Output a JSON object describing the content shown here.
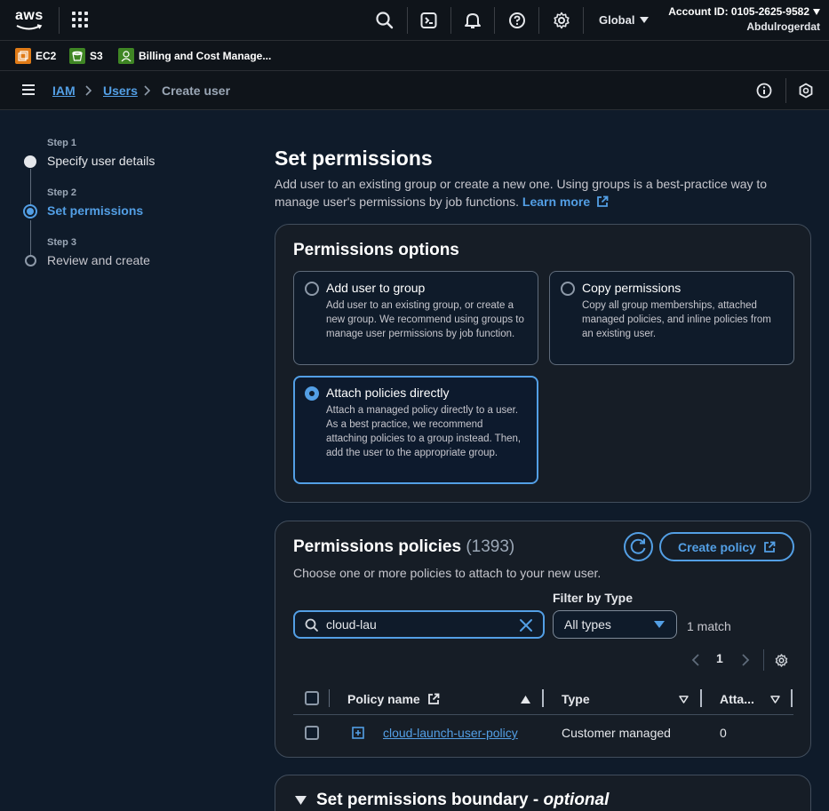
{
  "topnav": {
    "logo_text": "aws",
    "region_label": "Global",
    "account_label": "Account ID: 0105-2625-9582",
    "user_name": "Abdulrogerdat",
    "icons": [
      "grid-icon",
      "search-icon",
      "cloudshell-icon",
      "bell-icon",
      "help-icon",
      "gear-icon"
    ]
  },
  "favorites": [
    {
      "label": "EC2",
      "icon": "ec2-icon",
      "color": "#e07b17"
    },
    {
      "label": "S3",
      "icon": "s3-icon",
      "color": "#3f8624"
    },
    {
      "label": "Billing and Cost Manage...",
      "icon": "billing-icon",
      "color": "#3f8624"
    }
  ],
  "breadcrumb": {
    "items": [
      "IAM",
      "Users",
      "Create user"
    ]
  },
  "steps": [
    {
      "num": "Step 1",
      "title": "Specify user details",
      "state": "complete"
    },
    {
      "num": "Step 2",
      "title": "Set permissions",
      "state": "current"
    },
    {
      "num": "Step 3",
      "title": "Review and create",
      "state": "pending"
    }
  ],
  "main": {
    "title": "Set permissions",
    "description": "Add user to an existing group or create a new one. Using groups is a best-practice way to manage user's permissions by job functions.",
    "learn_more": "Learn more"
  },
  "permissions_options": {
    "heading": "Permissions options",
    "tiles": [
      {
        "title": "Add user to group",
        "desc": "Add user to an existing group, or create a new group. We recommend using groups to manage user permissions by job function.",
        "selected": false
      },
      {
        "title": "Copy permissions",
        "desc": "Copy all group memberships, attached managed policies, and inline policies from an existing user.",
        "selected": false
      },
      {
        "title": "Attach policies directly",
        "desc": "Attach a managed policy directly to a user. As a best practice, we recommend attaching policies to a group instead. Then, add the user to the appropriate group.",
        "selected": true
      }
    ]
  },
  "permissions_policies": {
    "heading": "Permissions policies",
    "count": "(1393)",
    "create_label": "Create policy",
    "description": "Choose one or more policies to attach to your new user.",
    "filter_label": "Filter by Type",
    "search_value": "cloud-lau",
    "type_value": "All types",
    "match_text": "1 match",
    "page_number": "1",
    "columns": [
      "Policy name",
      "Type",
      "Atta..."
    ],
    "rows": [
      {
        "name": "cloud-launch-user-policy",
        "type": "Customer managed",
        "attached": "0"
      }
    ]
  },
  "boundary": {
    "heading": "Set permissions boundary - ",
    "optional": "optional"
  },
  "colors": {
    "accent": "#539fe5",
    "background": "#0f1b2a",
    "container": "#161d26"
  }
}
